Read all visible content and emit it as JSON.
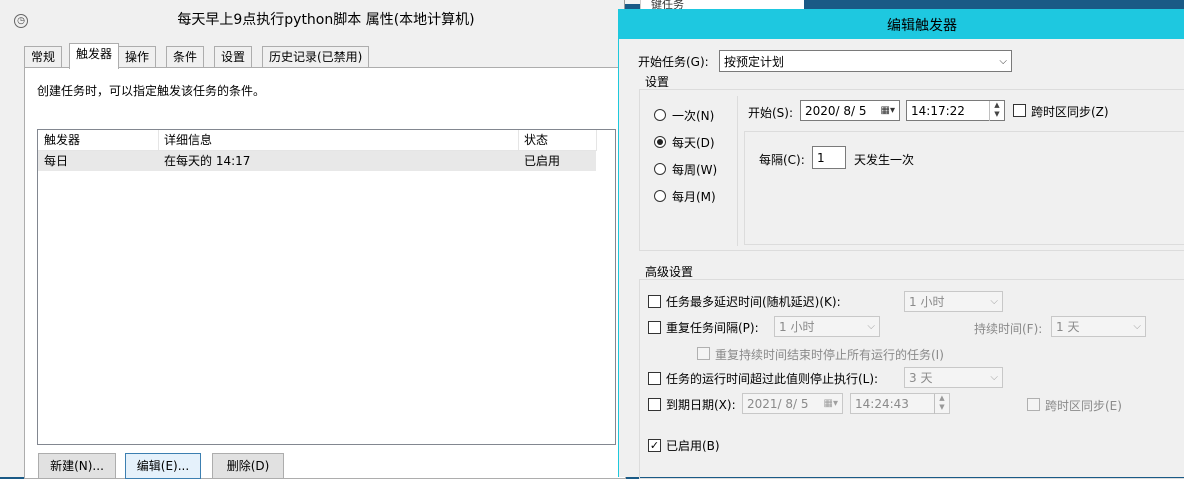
{
  "properties_window": {
    "title": "每天早上9点执行python脚本 属性(本地计算机)",
    "tabs": [
      "常规",
      "触发器",
      "操作",
      "条件",
      "设置",
      "历史记录(已禁用)"
    ],
    "description": "创建任务时，可以指定触发该任务的条件。",
    "table": {
      "columns": [
        "触发器",
        "详细信息",
        "状态"
      ],
      "rows": [
        [
          "每日",
          "在每天的 14:17",
          "已启用"
        ]
      ]
    },
    "buttons": {
      "new": "新建(N)...",
      "edit": "编辑(E)...",
      "delete": "删除(D)"
    }
  },
  "edit_trigger": {
    "title": "编辑触发器",
    "begin_task_label": "开始任务(G):",
    "begin_task_value": "按预定计划",
    "settings_header": "设置",
    "schedule_options": [
      "一次(N)",
      "每天(D)",
      "每周(W)",
      "每月(M)"
    ],
    "selected_schedule": "每天(D)",
    "start_label": "开始(S):",
    "start_date": "2020/ 8/ 5",
    "start_time": "14:17:22",
    "sync_tz_label": "跨时区同步(Z)",
    "recur_label": "每隔(C):",
    "recur_value": "1",
    "recur_suffix": "天发生一次",
    "advanced_header": "高级设置",
    "delay_label": "任务最多延迟时间(随机延迟)(K):",
    "delay_value": "1 小时",
    "repeat_label": "重复任务间隔(P):",
    "repeat_value": "1 小时",
    "duration_label": "持续时间(F):",
    "duration_value": "1 天",
    "stop_all_label": "重复持续时间结束时停止所有运行的任务(I)",
    "stop_if_label": "任务的运行时间超过此值则停止执行(L):",
    "stop_if_value": "3 天",
    "expire_label": "到期日期(X):",
    "expire_date": "2021/ 8/ 5",
    "expire_time": "14:24:43",
    "expire_sync_label": "跨时区同步(E)",
    "enabled_label": "已启用(B)"
  },
  "background": {
    "partial_text": "键任务"
  },
  "colors": {
    "title_accent": "#1ec8e0"
  }
}
